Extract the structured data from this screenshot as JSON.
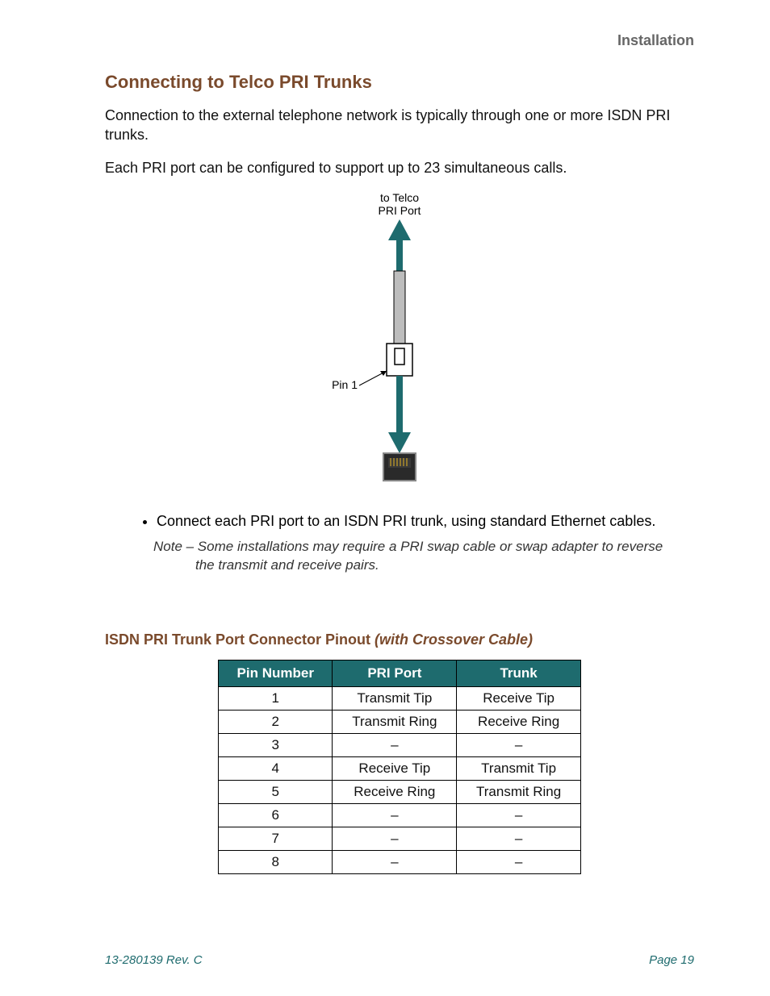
{
  "header": {
    "section": "Installation"
  },
  "section": {
    "title": "Connecting to Telco PRI Trunks",
    "para1": "Connection to the external telephone network is typically through one or more ISDN PRI trunks.",
    "para2": "Each PRI port can be configured to support up to 23 simultaneous calls."
  },
  "diagram": {
    "top_label_1": "to Telco",
    "top_label_2": "PRI Port",
    "pin_label": "Pin 1"
  },
  "bullet": {
    "text": "Connect each PRI port to an ISDN PRI trunk, using standard Ethernet cables."
  },
  "note": {
    "text": "Note – Some installations may require a PRI swap cable or swap adapter to reverse the transmit and receive pairs."
  },
  "subhead": {
    "plain": "ISDN PRI Trunk Port Connector Pinout ",
    "ital": "(with Crossover Cable)"
  },
  "table": {
    "headers": {
      "c1": "Pin Number",
      "c2": "PRI Port",
      "c3": "Trunk"
    },
    "rows": [
      {
        "pin": "1",
        "pri": "Transmit Tip",
        "trunk": "Receive Tip"
      },
      {
        "pin": "2",
        "pri": "Transmit Ring",
        "trunk": "Receive Ring"
      },
      {
        "pin": "3",
        "pri": "–",
        "trunk": "–"
      },
      {
        "pin": "4",
        "pri": "Receive Tip",
        "trunk": "Transmit Tip"
      },
      {
        "pin": "5",
        "pri": "Receive Ring",
        "trunk": "Transmit Ring"
      },
      {
        "pin": "6",
        "pri": "–",
        "trunk": "–"
      },
      {
        "pin": "7",
        "pri": "–",
        "trunk": "–"
      },
      {
        "pin": "8",
        "pri": "–",
        "trunk": "–"
      }
    ]
  },
  "footer": {
    "left": "13-280139  Rev. C",
    "right": "Page 19"
  }
}
